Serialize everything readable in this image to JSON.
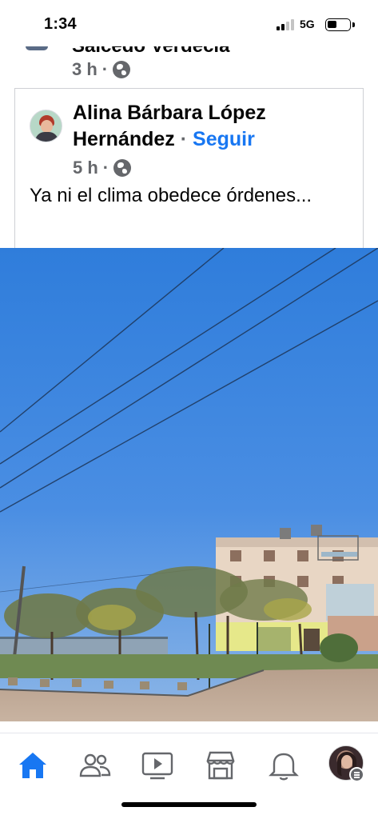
{
  "status_bar": {
    "time": "1:34",
    "network": "5G",
    "signal_bars_filled": 2,
    "battery_level": 0.45
  },
  "previous_post": {
    "author_name_partial": "Salcedo Verdecia",
    "time": "3 h",
    "separator": "·",
    "audience_icon": "globe-icon"
  },
  "shared_post": {
    "author_name": "Alina Bárbara López Hernández",
    "separator": "·",
    "follow_label": "Seguir",
    "time": "5 h",
    "audience_icon": "globe-icon",
    "text": "Ya ni el clima obedece órdenes...",
    "photo": "photo of clear blue sky over trees and apartment buildings"
  },
  "bottom_nav": {
    "items": [
      {
        "name": "home",
        "icon": "home-icon",
        "active": true
      },
      {
        "name": "friends",
        "icon": "friends-icon",
        "active": false
      },
      {
        "name": "video",
        "icon": "video-icon",
        "active": false
      },
      {
        "name": "marketplace",
        "icon": "marketplace-icon",
        "active": false
      },
      {
        "name": "notifications",
        "icon": "bell-icon",
        "active": false
      },
      {
        "name": "menu",
        "icon": "profile-avatar",
        "active": false
      }
    ]
  },
  "colors": {
    "accent": "#1877f2",
    "secondary_text": "#65676b",
    "sky": "#3f86de"
  }
}
